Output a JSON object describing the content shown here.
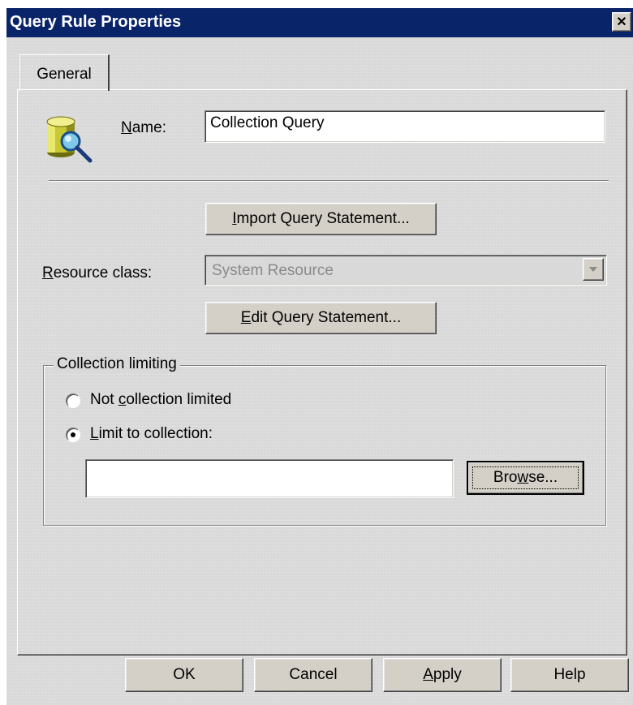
{
  "window": {
    "title": "Query Rule Properties",
    "close_glyph": "✕"
  },
  "tabs": [
    {
      "label": "General",
      "active": true
    }
  ],
  "general": {
    "icon": "database-search-icon",
    "name_label_prefix": "",
    "name_label_accel": "N",
    "name_label_rest": "ame:",
    "name_value": "Collection Query",
    "import_button": {
      "accel": "I",
      "rest": "mport Query Statement..."
    },
    "resource_class": {
      "label_accel": "R",
      "label_rest": "esource class:",
      "value": "System Resource",
      "enabled": false
    },
    "edit_button": {
      "accel": "E",
      "rest": "dit Query Statement..."
    },
    "collection_limiting": {
      "legend": "Collection limiting",
      "option_not_limited": {
        "prefix": "Not ",
        "accel": "c",
        "rest": "ollection limited",
        "selected": false
      },
      "option_limit": {
        "prefix": "",
        "accel": "L",
        "rest": "imit to collection:",
        "selected": true
      },
      "collection_value": "",
      "browse_button": {
        "prefix": "Bro",
        "accel": "w",
        "rest": "se..."
      }
    }
  },
  "footer": {
    "ok": "OK",
    "cancel": "Cancel",
    "apply": {
      "accel": "A",
      "rest": "pply"
    },
    "help": "Help"
  },
  "colors": {
    "titlebar": "#0a246a",
    "face": "#d9d9d9",
    "disabled_text": "#8a8a8a"
  }
}
